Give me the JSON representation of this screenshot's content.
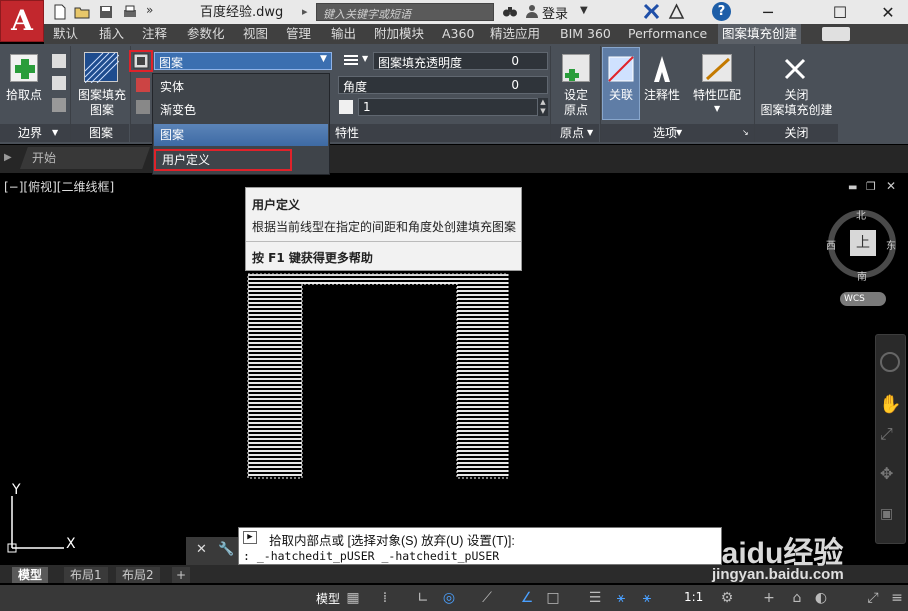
{
  "title_bar": {
    "document_title": "百度经验.dwg",
    "search_placeholder": "键入关键字或短语",
    "login": "登录",
    "help": "?"
  },
  "ribbon_tabs": [
    "默认",
    "插入",
    "注释",
    "参数化",
    "视图",
    "管理",
    "输出",
    "附加模块",
    "A360",
    "精选应用",
    "BIM 360",
    "Performance",
    "图案填充创建"
  ],
  "active_tab": "图案填充创建",
  "ribbon": {
    "pick_points": "拾取点",
    "boundary_panel": "边界",
    "pattern_panel_btn": "图案填充\n图案",
    "pattern_panel": "图案",
    "pattern_type_value": "图案",
    "hatch_transparency_label": "图案填充透明度",
    "transparency_value": "0",
    "angle_label": "角度",
    "angle_value": "0",
    "scale_value": "1",
    "properties_panel": "特性",
    "set_origin": "设定\n原点",
    "origin_panel": "原点",
    "associative": "关联",
    "annotative": "注释性",
    "match_properties": "特性匹配",
    "options_panel": "选项",
    "close_btn": "关闭\n图案填充创建",
    "close_panel": "关闭"
  },
  "dropdown_menu": {
    "items": [
      "实体",
      "渐变色",
      "图案",
      "用户定义"
    ],
    "highlighted": "图案",
    "boxed": "用户定义"
  },
  "file_tabs": {
    "start": "开始"
  },
  "viewport": {
    "label": "[−][俯视][二维线框]"
  },
  "tooltip": {
    "title": "用户定义",
    "description": "根据当前线型在指定的间距和角度处创建填充图案",
    "help": "按 F1 键获得更多帮助"
  },
  "viewcube": {
    "north": "北",
    "south": "南",
    "east": "东",
    "west": "西",
    "top": "上",
    "wcs": "WCS"
  },
  "ucs": {
    "x": "X",
    "y": "Y"
  },
  "command": {
    "prompt": "拾取内部点或 [选择对象(S) 放弃(U) 设置(T)]:",
    "history": ": _-hatchedit_pUSER _-hatchedit_pUSER"
  },
  "layout_tabs": [
    "模型",
    "布局1",
    "布局2"
  ],
  "status": {
    "model": "模型",
    "scale": "1:1"
  },
  "watermark": {
    "brand": "Baidu经验",
    "url": "jingyan.baidu.com"
  },
  "colors": {
    "app_red": "#c2272d",
    "highlight_box": "#e0222a",
    "menu_highlight": "#4a77b0",
    "ribbon_bg": "#4a5058"
  }
}
